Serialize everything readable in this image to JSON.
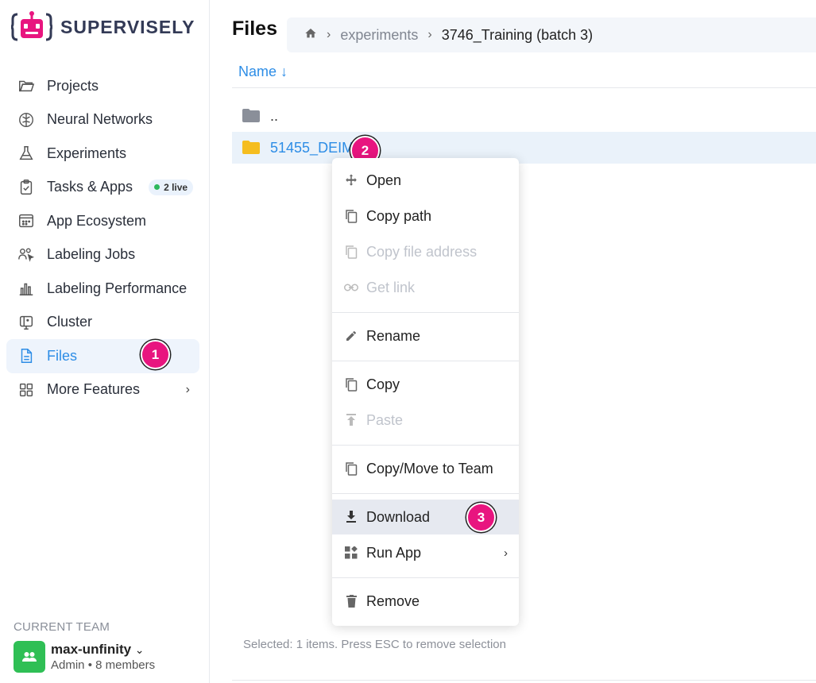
{
  "brand": {
    "name": "SUPERVISELY"
  },
  "sidebar": {
    "items": [
      {
        "label": "Projects",
        "icon": "folder-open-icon"
      },
      {
        "label": "Neural Networks",
        "icon": "brain-icon"
      },
      {
        "label": "Experiments",
        "icon": "flask-icon"
      },
      {
        "label": "Tasks & Apps",
        "icon": "clipboard-check-icon",
        "badge": "2 live"
      },
      {
        "label": "App Ecosystem",
        "icon": "app-window-icon"
      },
      {
        "label": "Labeling Jobs",
        "icon": "people-cursor-icon"
      },
      {
        "label": "Labeling Performance",
        "icon": "bar-chart-icon"
      },
      {
        "label": "Cluster",
        "icon": "server-icon"
      },
      {
        "label": "Files",
        "icon": "file-icon",
        "active": true
      },
      {
        "label": "More Features",
        "icon": "grid-icon"
      }
    ]
  },
  "team": {
    "section_label": "CURRENT TEAM",
    "name": "max-unfinity",
    "role": "Admin",
    "members": "8 members"
  },
  "main": {
    "title": "Files",
    "breadcrumb": [
      "experiments",
      "3746_Training (batch 3)"
    ],
    "column_header": "Name ↓",
    "rows": [
      {
        "name": "..",
        "type": "parent-folder"
      },
      {
        "name": "51455_DEIM",
        "type": "folder",
        "selected": true
      }
    ],
    "status": "Selected: 1 items. Press ESC to remove selection"
  },
  "context_menu": {
    "items": [
      {
        "label": "Open",
        "icon": "move-arrows-icon",
        "disabled": false
      },
      {
        "label": "Copy path",
        "icon": "copy-icon",
        "disabled": false
      },
      {
        "label": "Copy file address",
        "icon": "copy-icon",
        "disabled": true
      },
      {
        "label": "Get link",
        "icon": "link-icon",
        "disabled": true
      },
      {
        "label": "Rename",
        "icon": "pencil-icon",
        "disabled": false
      },
      {
        "label": "Copy",
        "icon": "copy-icon",
        "disabled": false
      },
      {
        "label": "Paste",
        "icon": "paste-icon",
        "disabled": true
      },
      {
        "label": "Copy/Move to Team",
        "icon": "copy-icon",
        "disabled": false
      },
      {
        "label": "Download",
        "icon": "download-icon",
        "disabled": false,
        "highlighted": true
      },
      {
        "label": "Run App",
        "icon": "apps-icon",
        "disabled": false,
        "submenu": true
      },
      {
        "label": "Remove",
        "icon": "trash-icon",
        "disabled": false
      }
    ]
  },
  "step_markers": [
    "1",
    "2",
    "3"
  ],
  "colors": {
    "accent": "#2d8de6",
    "marker": "#e8157f",
    "team_avatar": "#2fbf55",
    "folder": "#f5bd1f"
  }
}
